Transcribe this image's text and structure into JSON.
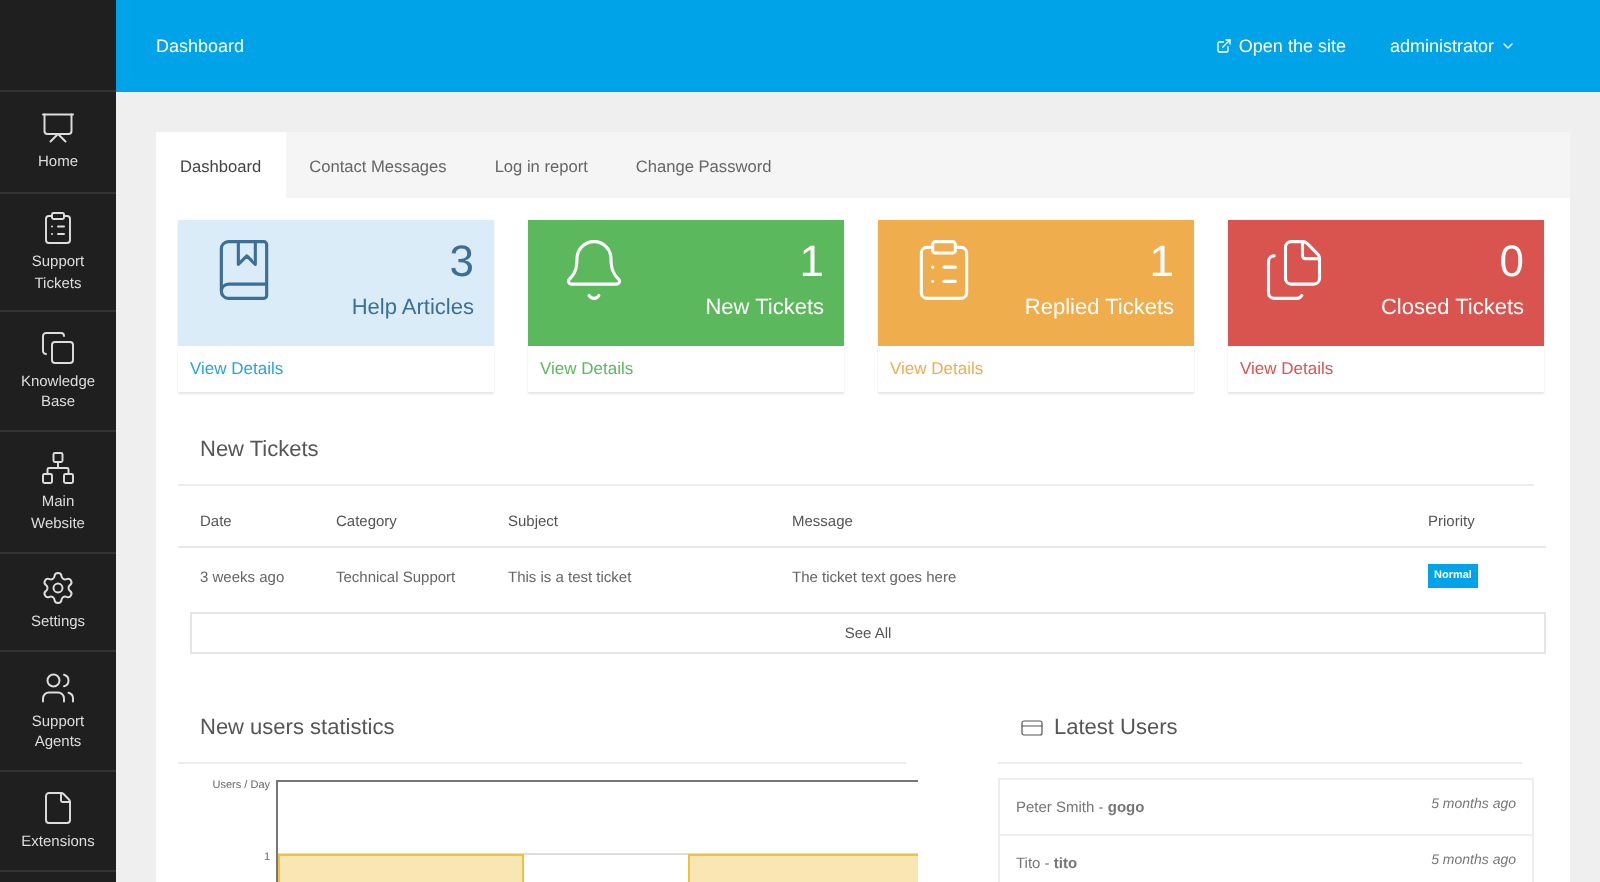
{
  "topbar": {
    "title": "Dashboard",
    "open_site": "Open the site",
    "user": "administrator"
  },
  "sidebar": {
    "items": [
      {
        "label": "Home"
      },
      {
        "label": "Support Tickets"
      },
      {
        "label": "Knowledge Base"
      },
      {
        "label": "Main Website"
      },
      {
        "label": "Settings"
      },
      {
        "label": "Support Agents"
      },
      {
        "label": "Extensions"
      }
    ]
  },
  "tabs": [
    {
      "label": "Dashboard",
      "selected": true
    },
    {
      "label": "Contact Messages",
      "selected": false
    },
    {
      "label": "Log in report",
      "selected": false
    },
    {
      "label": "Change Password",
      "selected": false
    }
  ],
  "cards": [
    {
      "count": "3",
      "label": "Help Articles",
      "link": "View Details",
      "kind": "light",
      "color": "#d9ecf7"
    },
    {
      "count": "1",
      "label": "New Tickets",
      "link": "View Details",
      "kind": "solid",
      "color": "#5cb85c"
    },
    {
      "count": "1",
      "label": "Replied Tickets",
      "link": "View Details",
      "kind": "solid",
      "color": "#f0ad4e"
    },
    {
      "count": "0",
      "label": "Closed Tickets",
      "link": "View Details",
      "kind": "solid",
      "color": "#d9534f"
    }
  ],
  "new_tickets": {
    "title": "New Tickets",
    "columns": [
      "Date",
      "Category",
      "Subject",
      "Message",
      "Priority"
    ],
    "rows": [
      {
        "cells": [
          "3 weeks ago",
          "Technical Support",
          "This is a test ticket",
          "The ticket text goes here"
        ],
        "priority": "Normal"
      }
    ],
    "see_all": "See All"
  },
  "statistics": {
    "title": "New users statistics",
    "ylabel": "Users / Day",
    "ytick": "1"
  },
  "latest_users": {
    "title": "Latest Users",
    "users": [
      {
        "name": "Peter Smith - **gogo**",
        "time": "5 months ago"
      },
      {
        "name": "Tito - **tito**",
        "time": "5 months ago"
      }
    ]
  }
}
